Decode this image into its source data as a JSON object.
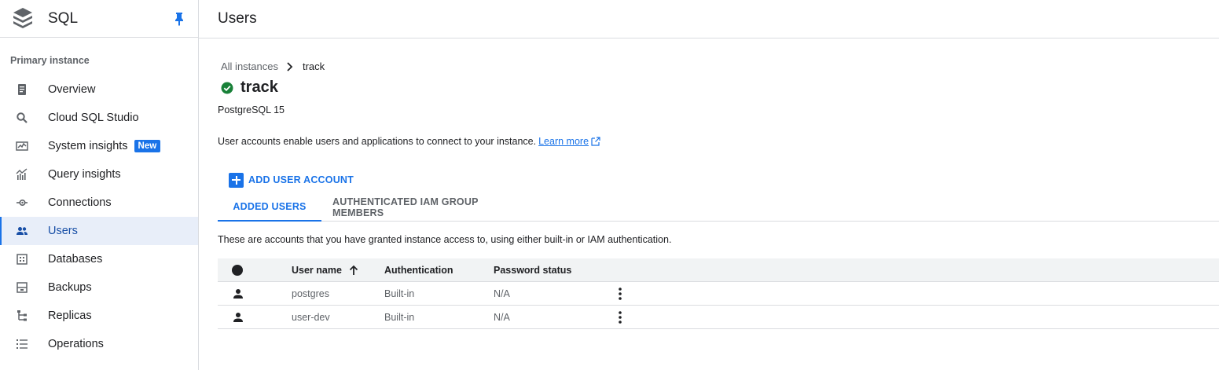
{
  "app": {
    "title": "SQL",
    "page_title": "Users"
  },
  "sidebar": {
    "section_title": "Primary instance",
    "items": [
      {
        "label": "Overview",
        "icon": "overview-icon"
      },
      {
        "label": "Cloud SQL Studio",
        "icon": "search-icon"
      },
      {
        "label": "System insights",
        "icon": "monitoring-icon",
        "badge": "New"
      },
      {
        "label": "Query insights",
        "icon": "chart-icon"
      },
      {
        "label": "Connections",
        "icon": "connection-icon"
      },
      {
        "label": "Users",
        "icon": "people-icon",
        "active": true
      },
      {
        "label": "Databases",
        "icon": "database-icon"
      },
      {
        "label": "Backups",
        "icon": "backup-icon"
      },
      {
        "label": "Replicas",
        "icon": "replica-icon"
      },
      {
        "label": "Operations",
        "icon": "list-icon"
      }
    ]
  },
  "breadcrumb": {
    "link": "All instances",
    "current": "track"
  },
  "instance": {
    "name": "track",
    "version": "PostgreSQL 15",
    "status_color": "#188038"
  },
  "description": {
    "text": "User accounts enable users and applications to connect to your instance.",
    "link": "Learn more"
  },
  "actions": {
    "add_user": "ADD USER ACCOUNT"
  },
  "tabs": [
    {
      "label": "ADDED USERS",
      "active": true
    },
    {
      "label": "AUTHENTICATED IAM GROUP MEMBERS",
      "active": false
    }
  ],
  "table": {
    "description": "These are accounts that you have granted instance access to, using either built-in or IAM authentication.",
    "headers": {
      "name": "User name",
      "auth": "Authentication",
      "password": "Password status"
    },
    "rows": [
      {
        "name": "postgres",
        "auth": "Built-in",
        "password": "N/A"
      },
      {
        "name": "user-dev",
        "auth": "Built-in",
        "password": "N/A"
      }
    ]
  },
  "colors": {
    "accent": "#1a73e8",
    "active_bg": "#e8eef9",
    "border": "#dadce0"
  }
}
